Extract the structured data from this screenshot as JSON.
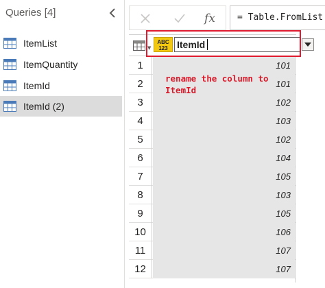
{
  "queries": {
    "header": "Queries [4]",
    "items": [
      {
        "label": "ItemList",
        "selected": false
      },
      {
        "label": "ItemQuantity",
        "selected": false
      },
      {
        "label": "ItemId",
        "selected": false
      },
      {
        "label": "ItemId (2)",
        "selected": true
      }
    ]
  },
  "formula_bar": {
    "formula": "= Table.FromList",
    "fx_label": "fx"
  },
  "column": {
    "type_badge_top": "ABC",
    "type_badge_bottom": "123",
    "name_value": "ItemId"
  },
  "annotation": {
    "text": "rename the column to ItemId",
    "color": "#d81b2b"
  },
  "rows": [
    {
      "n": "1",
      "v": "101"
    },
    {
      "n": "2",
      "v": "101"
    },
    {
      "n": "3",
      "v": "102"
    },
    {
      "n": "4",
      "v": "103"
    },
    {
      "n": "5",
      "v": "102"
    },
    {
      "n": "6",
      "v": "104"
    },
    {
      "n": "7",
      "v": "105"
    },
    {
      "n": "8",
      "v": "103"
    },
    {
      "n": "9",
      "v": "105"
    },
    {
      "n": "10",
      "v": "106"
    },
    {
      "n": "11",
      "v": "107"
    },
    {
      "n": "12",
      "v": "107"
    }
  ],
  "colors": {
    "highlight": "#e01a2f",
    "type_badge": "#f2c811",
    "selected_query_bg": "#dcdcdc",
    "cell_bg": "#e6e6e6"
  }
}
